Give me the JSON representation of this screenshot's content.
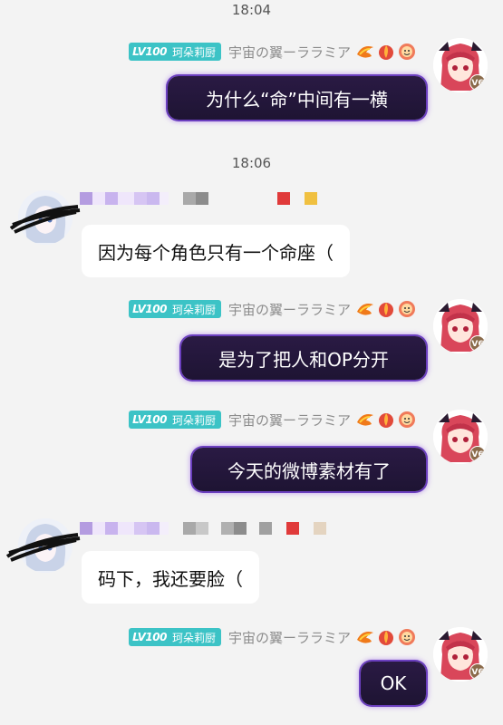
{
  "timestamps": [
    "18:04",
    "18:06"
  ],
  "self_user": {
    "level_badge": "LV100",
    "title": "珂朵莉厨",
    "nickname": "宇宙の翼ーララミア",
    "vip": "V6"
  },
  "messages": [
    {
      "side": "self",
      "text": "为什么“命”中间有一横"
    },
    {
      "side": "other",
      "text": "因为每个角色只有一个命座（"
    },
    {
      "side": "self",
      "text": "是为了把人和OP分开"
    },
    {
      "side": "self",
      "text": "今天的微博素材有了"
    },
    {
      "side": "other",
      "text": "码下，我还要脸（"
    },
    {
      "side": "self",
      "text": "OK"
    }
  ],
  "colors": {
    "background": "#f3f3f3",
    "self_bubble": "#1e1433",
    "self_bubble_glow": "#6b3fbf",
    "other_bubble": "#ffffff",
    "level_badge": "#3cc3c6"
  },
  "icons": [
    "phoenix-medal-icon",
    "fire-medal-icon",
    "face-medal-icon",
    "anime-avatar-icon"
  ]
}
